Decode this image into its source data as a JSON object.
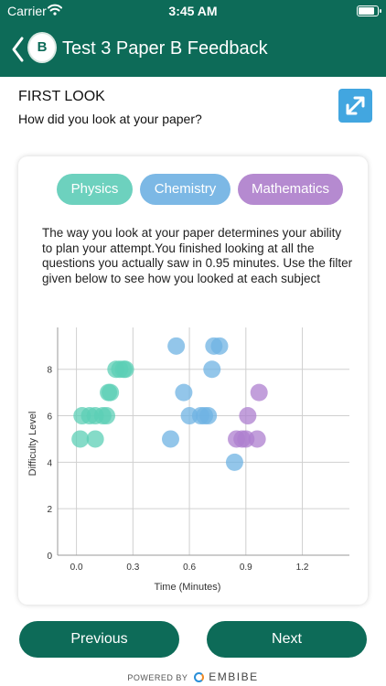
{
  "status_bar": {
    "carrier": "Carrier",
    "time": "3:45 AM",
    "battery_level": 0.9
  },
  "header": {
    "title": "Test 3 Paper B Feedback",
    "logo_text": "B",
    "icon_back": "chevron-left-icon"
  },
  "section": {
    "title": "FIRST LOOK",
    "subtitle": "How did you look at your paper?",
    "expand_icon": "expand-icon"
  },
  "filters": [
    {
      "label": "Physics",
      "color": "#6dd1be"
    },
    {
      "label": "Chemistry",
      "color": "#7cb8e5"
    },
    {
      "label": "Mathematics",
      "color": "#b58ad0"
    }
  ],
  "description": "The way you look at your paper determines your ability to plan your attempt.You finished looking at all the questions you actually saw in 0.95 minutes. Use the filter given below to see how you looked at each subject",
  "chart_data": {
    "type": "scatter",
    "xlabel": "Time (Minutes)",
    "ylabel": "Difficulty Level",
    "xlim": [
      -0.1,
      1.45
    ],
    "ylim": [
      0,
      9.8
    ],
    "xticks": [
      0.0,
      0.3,
      0.6,
      0.9,
      1.2
    ],
    "xtick_labels": [
      "0.0",
      "0.3",
      "0.6",
      "0.9",
      "1.2"
    ],
    "yticks": [
      0,
      2,
      4,
      6,
      8
    ],
    "ytick_labels": [
      "0",
      "2",
      "4",
      "6",
      "8"
    ],
    "grid": true,
    "series": [
      {
        "name": "Physics",
        "color": "#5ccfb5",
        "points": [
          [
            0.02,
            5
          ],
          [
            0.1,
            5
          ],
          [
            0.03,
            6
          ],
          [
            0.07,
            6
          ],
          [
            0.1,
            6
          ],
          [
            0.14,
            6
          ],
          [
            0.16,
            6
          ],
          [
            0.17,
            7
          ],
          [
            0.18,
            7
          ],
          [
            0.21,
            8
          ],
          [
            0.23,
            8
          ],
          [
            0.25,
            8
          ],
          [
            0.26,
            8
          ]
        ]
      },
      {
        "name": "Chemistry",
        "color": "#6fb3e3",
        "points": [
          [
            0.53,
            9
          ],
          [
            0.73,
            9
          ],
          [
            0.76,
            9
          ],
          [
            0.72,
            8
          ],
          [
            0.57,
            7
          ],
          [
            0.6,
            6
          ],
          [
            0.66,
            6
          ],
          [
            0.68,
            6
          ],
          [
            0.7,
            6
          ],
          [
            0.5,
            5
          ],
          [
            0.84,
            4
          ]
        ]
      },
      {
        "name": "Mathematics",
        "color": "#ad7fcf",
        "points": [
          [
            0.97,
            7
          ],
          [
            0.91,
            6
          ],
          [
            0.85,
            5
          ],
          [
            0.88,
            5
          ],
          [
            0.9,
            5
          ],
          [
            0.96,
            5
          ]
        ]
      }
    ]
  },
  "buttons": {
    "previous": "Previous",
    "next": "Next"
  },
  "footer": {
    "powered_by": "POWERED BY",
    "brand": "EMBIBE"
  }
}
